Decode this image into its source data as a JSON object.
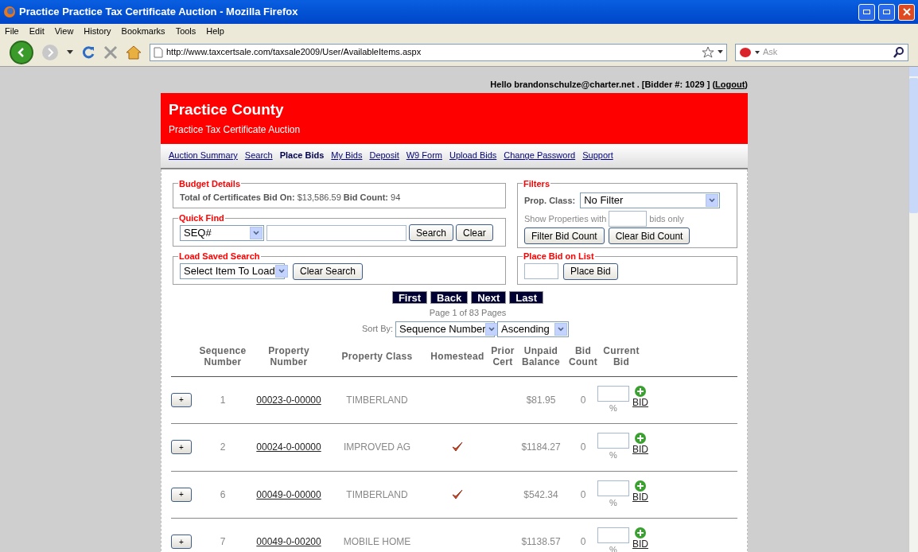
{
  "window": {
    "title": "Practice Practice Tax Certificate Auction - Mozilla Firefox"
  },
  "menu": [
    "File",
    "Edit",
    "View",
    "History",
    "Bookmarks",
    "Tools",
    "Help"
  ],
  "address": "http://www.taxcertsale.com/taxsale2009/User/AvailableItems.aspx",
  "search": {
    "placeholder": "Ask"
  },
  "greeting": {
    "text": "Hello brandonschulze@charter.net . [Bidder #: 1029 ] (",
    "logout": "Logout",
    "close": ")"
  },
  "header": {
    "title": "Practice County",
    "subtitle": "Practice Tax Certificate Auction"
  },
  "nav": [
    {
      "label": "Auction Summary",
      "selected": false
    },
    {
      "label": "Search",
      "selected": false
    },
    {
      "label": "Place Bids",
      "selected": true
    },
    {
      "label": "My Bids",
      "selected": false
    },
    {
      "label": "Deposit",
      "selected": false
    },
    {
      "label": "W9 Form",
      "selected": false
    },
    {
      "label": "Upload Bids",
      "selected": false
    },
    {
      "label": "Change Password",
      "selected": false
    },
    {
      "label": "Support",
      "selected": false
    }
  ],
  "budget": {
    "legend": "Budget Details",
    "text": "**Total of Certificates Bid On:** $13,586.59 **Bid Count:** 94"
  },
  "quick_find": {
    "legend": "Quick Find",
    "select": "SEQ#",
    "buttons": [
      "Search",
      "Clear"
    ]
  },
  "saved_search": {
    "legend": "Load Saved Search",
    "select": "Select Item To Load",
    "button": "Clear Search"
  },
  "filters": {
    "legend": "Filters",
    "prop_label": "Prop. Class:",
    "prop_select": "No Filter",
    "show_before": "Show Properties with",
    "show_after": "bids only",
    "buttons": [
      "Filter Bid Count",
      "Clear Bid Count"
    ]
  },
  "place_bid": {
    "legend": "Place Bid on List",
    "button": "Place Bid"
  },
  "pager": [
    "First",
    "Back",
    "Next",
    "Last"
  ],
  "page_info": "Page 1 of 83 Pages",
  "sort": {
    "label": "Sort By:",
    "field": "Sequence Number",
    "order": "Ascending"
  },
  "table": {
    "columns": [
      "Sequence Number",
      "Property Number",
      "Property Class",
      "Homestead",
      "Prior Cert",
      "Unpaid Balance",
      "Bid Count",
      "Current Bid"
    ],
    "rows": [
      {
        "expand": "+",
        "seq": "1",
        "property": "00023-0-00000",
        "class": "TIMBERLAND",
        "homestead": false,
        "unpaid": "$81.95",
        "bid_count": "0",
        "percent": "%",
        "bid": "BID"
      },
      {
        "expand": "+",
        "seq": "2",
        "property": "00024-0-00000",
        "class": "IMPROVED AG",
        "homestead": true,
        "unpaid": "$1184.27",
        "bid_count": "0",
        "percent": "%",
        "bid": "BID"
      },
      {
        "expand": "+",
        "seq": "6",
        "property": "00049-0-00000",
        "class": "TIMBERLAND",
        "homestead": true,
        "unpaid": "$542.34",
        "bid_count": "0",
        "percent": "%",
        "bid": "BID"
      },
      {
        "expand": "+",
        "seq": "7",
        "property": "00049-0-00200",
        "class": "MOBILE HOME",
        "homestead": false,
        "unpaid": "$1138.57",
        "bid_count": "0",
        "percent": "%",
        "bid": "BID"
      }
    ]
  }
}
